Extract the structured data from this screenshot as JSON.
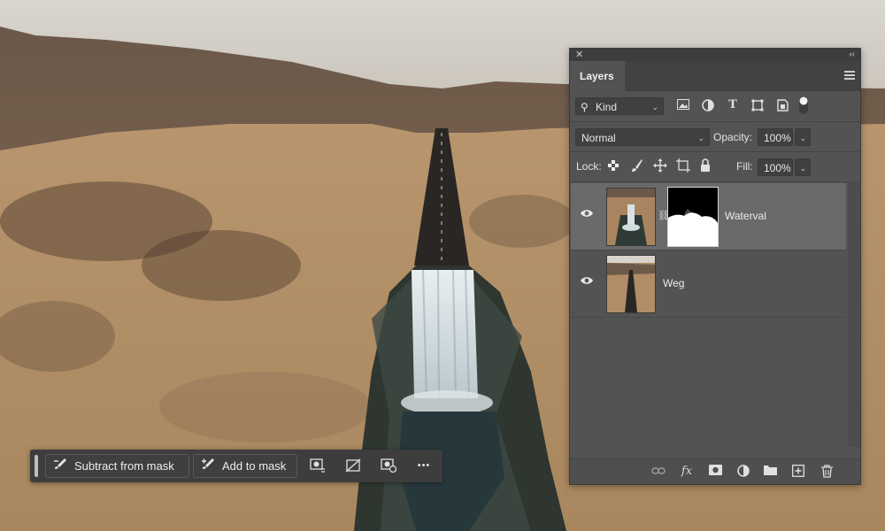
{
  "panel": {
    "tab_label": "Layers",
    "filter": {
      "kind_label": "Kind"
    },
    "blend_mode": "Normal",
    "opacity_label": "Opacity:",
    "opacity_value": "100%",
    "lock_label": "Lock:",
    "fill_label": "Fill:",
    "fill_value": "100%",
    "layers": [
      {
        "name": "Waterval",
        "selected": true,
        "has_mask": true
      },
      {
        "name": "Weg",
        "selected": false,
        "has_mask": false
      }
    ]
  },
  "taskbar": {
    "subtract_label": "Subtract from mask",
    "add_label": "Add to mask",
    "more_label": "•••"
  },
  "icons": {
    "close": "close-icon",
    "collapse": "collapse-icon",
    "menu": "panel-menu-icon",
    "search": "search-icon",
    "eye": "eye-icon",
    "link": "chain-link-icon"
  }
}
